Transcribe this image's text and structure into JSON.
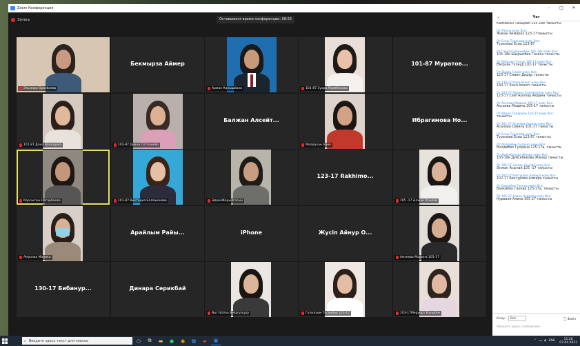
{
  "window": {
    "title": "Zoom Конференция",
    "min": "–",
    "max": "□",
    "close": "✕"
  },
  "meeting": {
    "record_label": "Запись",
    "timer_text": "Оставшееся время конференции: 08:55"
  },
  "tiles": [
    {
      "name_label": "Эльмира Оразбаева",
      "big_name": ""
    },
    {
      "name_label": "",
      "big_name": "Бекмырза Аймер"
    },
    {
      "name_label": "Арман Калышбаев",
      "big_name": ""
    },
    {
      "name_label": "101-87 Зухра Раимбекова",
      "big_name": ""
    },
    {
      "name_label": "",
      "big_name": "101-87 Муратов..."
    },
    {
      "name_label": "101.87 Дана Шонадова",
      "big_name": ""
    },
    {
      "name_label": "102-87 Диана Сеталиева",
      "big_name": ""
    },
    {
      "name_label": "",
      "big_name": "Балжан Алсейт..."
    },
    {
      "name_label": "Молдахан Алия",
      "big_name": ""
    },
    {
      "name_label": "",
      "big_name": "Ибрагимова Но..."
    },
    {
      "name_label": "Карлыгаш Нагарбаева",
      "big_name": ""
    },
    {
      "name_label": "101-87 Виктория Балажонова",
      "big_name": ""
    },
    {
      "name_label": "ӘдемiЖарылгасын",
      "big_name": ""
    },
    {
      "name_label": "",
      "big_name": "123-17 Rakhimo..."
    },
    {
      "name_label": "105 -17 Әлжан Асылай",
      "big_name": ""
    },
    {
      "name_label": "Амурова Малика",
      "big_name": ""
    },
    {
      "name_label": "",
      "big_name": "Арайлым Райы..."
    },
    {
      "name_label": "",
      "big_name": "iPhone"
    },
    {
      "name_label": "",
      "big_name": "Жусiп Айнур О..."
    },
    {
      "name_label": "Амзеева Мадина 105-17",
      "big_name": ""
    },
    {
      "name_label": "",
      "big_name": "130-17 Бибинур..."
    },
    {
      "name_label": "",
      "big_name": "Динара Серикбай"
    },
    {
      "name_label": "Nur Fatima Bekaryssyzy",
      "big_name": ""
    },
    {
      "name_label": "Гулназым Тоганбек 123-17",
      "big_name": ""
    },
    {
      "name_label": "103-17Меруерт Калыбек",
      "big_name": ""
    }
  ],
  "chat": {
    "collapse": "⌄",
    "title": "Чат",
    "messages": [
      {
        "from": "",
        "text": "Калмакан Танырам 105-18к танысты"
      },
      {
        "from": "От iPhone кому Все:",
        "text": "Жакан Акмарал 123-17танысты"
      },
      {
        "from": "От Есеш Туранова кому Все:",
        "text": "Туранова Есиа 123-87"
      },
      {
        "from": "От Газиза Шырымбек 105-18к кому Все:",
        "text": "105-18к Шырымбек Газиза танысты"
      },
      {
        "from": "От Өмірзақ Гүлнұр 102-17 кому Все:",
        "text": "Өмірзақ Гүлнұр 102-17 танысты"
      },
      {
        "from": "От Дидар Смайл кому Все:",
        "text": "123-17 Смаил Дидар танысты"
      },
      {
        "from": "От 130-17 Кахп Акжет кому Все:",
        "text": "130-17 Кахп Акжет танысты"
      },
      {
        "from": "От 123-17 Айдана Сейтжаппар кому Все:",
        "text": "123-17 Сейтжаппар Айдана танысты"
      },
      {
        "from": "От Аксаева Мадина 105-17 кому Все:",
        "text": "Аксаева Мадина 105-17 танысты"
      },
      {
        "from": "От Айдан Сапаралы 123-17 кому Все:",
        "text": "танысты"
      },
      {
        "from": "От 101-17 Асанова Севиль кому Все:",
        "text": "Асанова Севиль 101-17 танысты"
      },
      {
        "from": "От Есеш Туранова кому Все:",
        "text": "Туранова Есиа 123-87 танысты"
      },
      {
        "from": "От Малдебек Гулдана кому Все:",
        "text": "Малдебек Гулдана 125-17а, танысты"
      },
      {
        "from": "От Дуйсебекова Жанар кому Все:",
        "text": "105-18к Дуйсебекова Жанар танысты"
      },
      {
        "from": "От 105-17 Әлжан Асылай кому Все:",
        "text": "Әлжан Асылай 105 -17 танысты"
      },
      {
        "from": "От 102-17 Бектурова Алмира кому Все:",
        "text": "102-17 Бектурова Алмира танысты"
      },
      {
        "from": "От Балкибек Гаунар кому Все:",
        "text": "Балкибек Гаунар 125-17а, танысты"
      },
      {
        "from": "От 105-27 Алина Нурвали кому Все:",
        "text": "Нурвали Алина 105-27 танысты"
      }
    ],
    "to_label": "Кому:",
    "to_value": "Все",
    "file_label": "Файл",
    "input_placeholder": "Введите здесь сообщение..."
  },
  "taskbar": {
    "search_placeholder": "Введите здесь текст для поиска",
    "lang": "ENG",
    "time": "11:26",
    "date": "07.04.2021"
  },
  "colors": {
    "accent": "#2d8cff",
    "active_speaker": "#e8e062",
    "recording": "#e02a2a"
  }
}
